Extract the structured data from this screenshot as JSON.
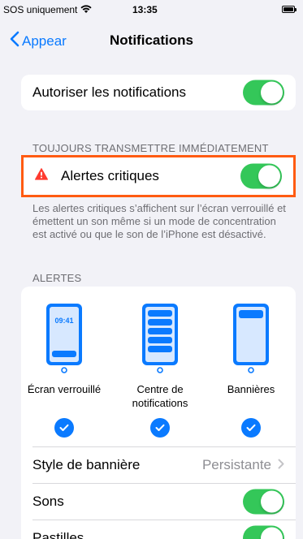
{
  "status_bar": {
    "carrier": "SOS uniquement",
    "time": "13:35"
  },
  "nav": {
    "back_label": "Appear",
    "title": "Notifications"
  },
  "allow_row": {
    "label": "Autoriser les notifications",
    "enabled": true
  },
  "critical_section": {
    "header": "TOUJOURS TRANSMETTRE IMMÉDIATEMENT",
    "label": "Alertes critiques",
    "enabled": true,
    "footer": "Les alertes critiques s’affichent sur l’écran verrouillé et émettent un son même si un mode de concentration est activé ou que le son de l’iPhone est désactivé."
  },
  "alerts_section": {
    "header": "ALERTES",
    "lock_screen_time": "09:41",
    "options": [
      {
        "label": "Écran verrouillé",
        "checked": true
      },
      {
        "label": "Centre de notifications",
        "checked": true
      },
      {
        "label": "Bannières",
        "checked": true
      }
    ]
  },
  "banner_style": {
    "label": "Style de bannière",
    "value": "Persistante"
  },
  "sounds": {
    "label": "Sons",
    "enabled": true
  },
  "badges": {
    "label": "Pastilles",
    "enabled": true
  },
  "colors": {
    "accent": "#0a7aff",
    "toggle_on": "#34c759",
    "highlight": "#ff5b12",
    "warning": "#ff3b30"
  }
}
